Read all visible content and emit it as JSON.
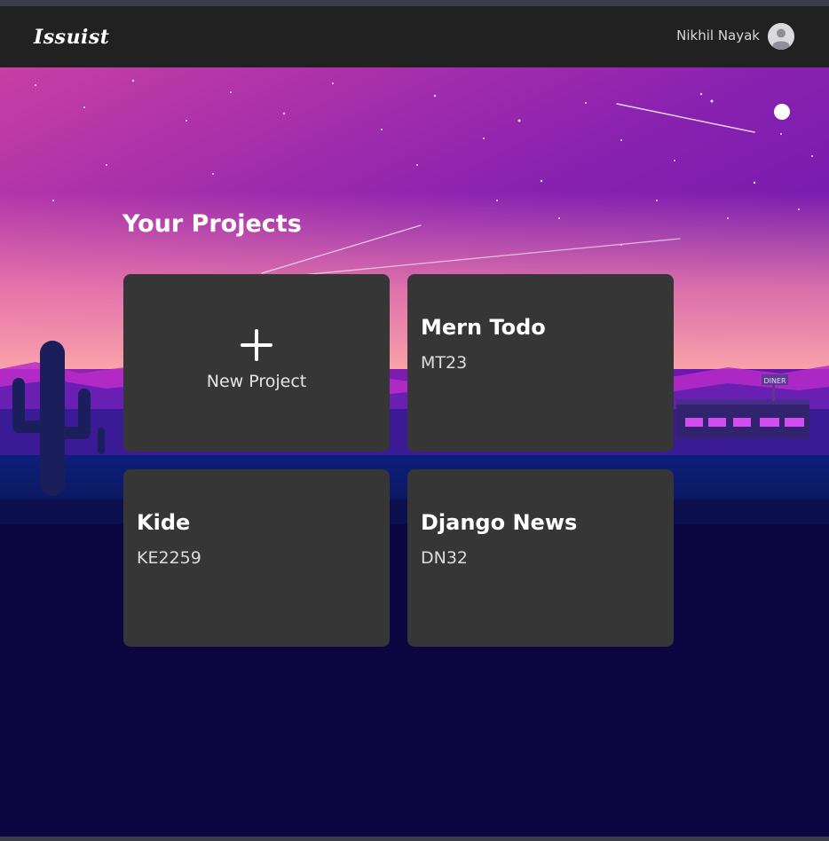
{
  "navbar": {
    "brand": "Issuist",
    "user_name": "Nikhil Nayak",
    "avatar_icon": "user-avatar-icon"
  },
  "main": {
    "title": "Your Projects",
    "new_project": {
      "label": "New Project",
      "icon": "plus-icon"
    },
    "projects": [
      {
        "name": "Mern Todo",
        "key": "MT23"
      },
      {
        "name": "Kide",
        "key": "KE2259"
      },
      {
        "name": "Django News",
        "key": "DN32"
      }
    ]
  },
  "background": {
    "sign_text": "DINER"
  },
  "colors": {
    "navbar": "#212121",
    "card": "#363636",
    "page_bottom": "#0e0640"
  }
}
